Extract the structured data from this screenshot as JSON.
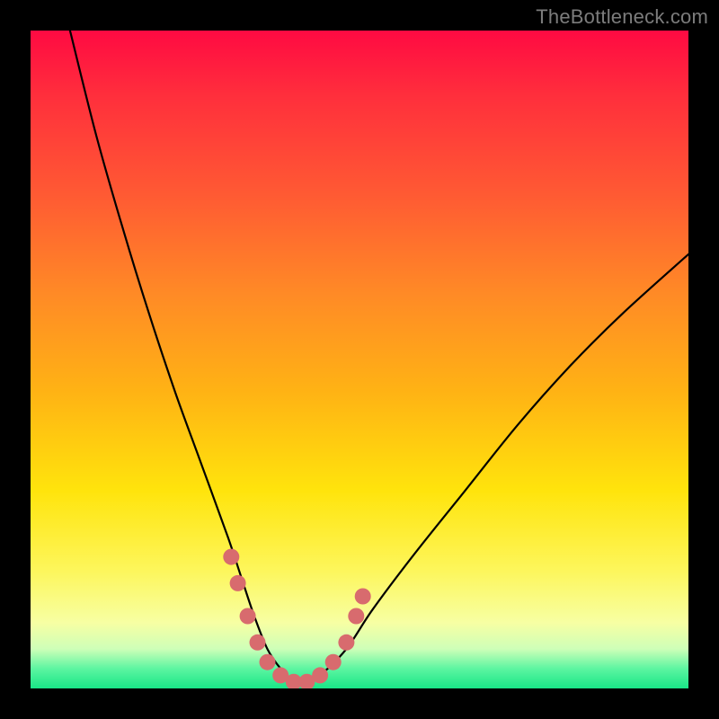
{
  "watermark": "TheBottleneck.com",
  "chart_data": {
    "type": "line",
    "title": "",
    "xlabel": "",
    "ylabel": "",
    "xlim": [
      0,
      100
    ],
    "ylim": [
      0,
      100
    ],
    "gradient_stops": [
      {
        "pos": 0,
        "color": "#ff0a42"
      },
      {
        "pos": 10,
        "color": "#ff2f3c"
      },
      {
        "pos": 25,
        "color": "#ff5a33"
      },
      {
        "pos": 40,
        "color": "#ff8a26"
      },
      {
        "pos": 55,
        "color": "#ffb314"
      },
      {
        "pos": 70,
        "color": "#ffe40c"
      },
      {
        "pos": 82,
        "color": "#fdf65b"
      },
      {
        "pos": 90,
        "color": "#f7ffa3"
      },
      {
        "pos": 94,
        "color": "#ceffb8"
      },
      {
        "pos": 97,
        "color": "#5cf5a1"
      },
      {
        "pos": 100,
        "color": "#19e687"
      }
    ],
    "series": [
      {
        "name": "bottleneck-curve",
        "x": [
          6,
          10,
          14,
          18,
          22,
          26,
          30,
          32,
          34,
          36,
          38,
          40,
          42,
          44,
          48,
          52,
          58,
          66,
          74,
          82,
          90,
          100
        ],
        "y": [
          100,
          84,
          70,
          57,
          45,
          34,
          23,
          17,
          11,
          6,
          3,
          1,
          1,
          2,
          6,
          12,
          20,
          30,
          40,
          49,
          57,
          66
        ]
      }
    ],
    "markers": {
      "name": "highlight-dots",
      "color": "#d86b6e",
      "points": [
        {
          "x": 30.5,
          "y": 20
        },
        {
          "x": 31.5,
          "y": 16
        },
        {
          "x": 33.0,
          "y": 11
        },
        {
          "x": 34.5,
          "y": 7
        },
        {
          "x": 36.0,
          "y": 4
        },
        {
          "x": 38.0,
          "y": 2
        },
        {
          "x": 40.0,
          "y": 1
        },
        {
          "x": 42.0,
          "y": 1
        },
        {
          "x": 44.0,
          "y": 2
        },
        {
          "x": 46.0,
          "y": 4
        },
        {
          "x": 48.0,
          "y": 7
        },
        {
          "x": 49.5,
          "y": 11
        },
        {
          "x": 50.5,
          "y": 14
        }
      ]
    }
  }
}
